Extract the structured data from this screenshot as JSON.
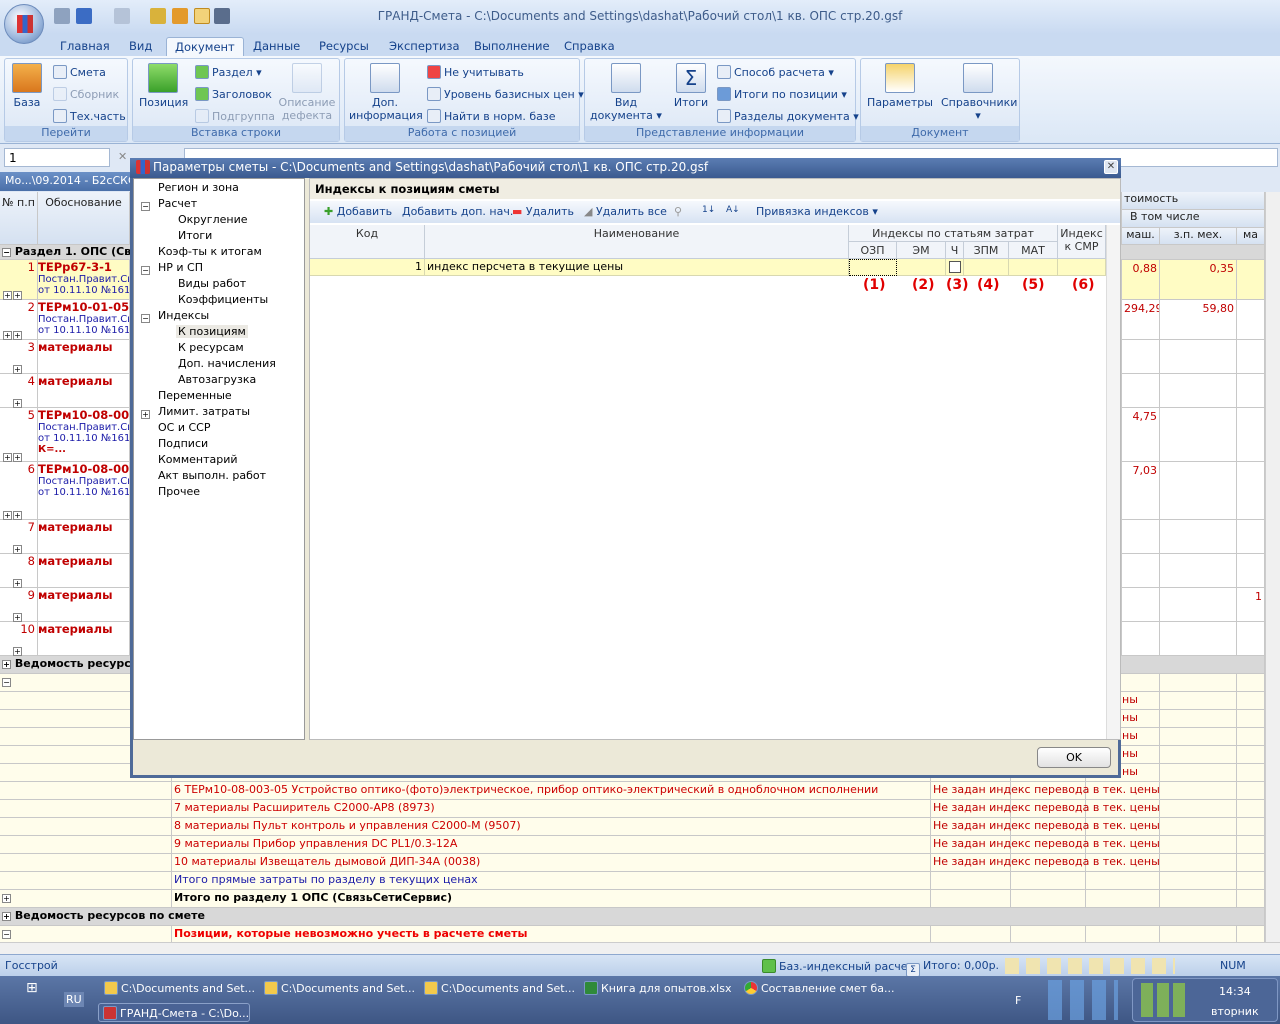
{
  "app": {
    "title": "ГРАНД-Смета - C:\\Documents and Settings\\dashat\\Рабочий стол\\1 кв.  ОПС стр.20.gsf"
  },
  "tabs": [
    "Главная",
    "Вид",
    "Документ",
    "Данные",
    "Ресурсы",
    "Экспертиза",
    "Выполнение",
    "Справка"
  ],
  "active_tab": "Документ",
  "ribbon": {
    "goto": {
      "label": "Перейти",
      "baza": "База",
      "smeta": "Смета",
      "sbornik": "Сборник",
      "techpart": "Тех.часть"
    },
    "insert": {
      "label": "Вставка строки",
      "position": "Позиция",
      "razdel": "Раздел",
      "zagolovok": "Заголовок",
      "podgruppa": "Подгруппа",
      "defect": "Описание дефекта"
    },
    "work": {
      "label": "Работа с позицией",
      "dop": "Доп. информация",
      "ne_uchit": "Не учитывать",
      "uroven": "Уровень базисных цен",
      "naiti": "Найти в норм. базе"
    },
    "view": {
      "label": "Представление информации",
      "vid": "Вид документа",
      "itogi": "Итоги",
      "sposob": "Способ расчета",
      "itogi_poz": "Итоги по позиции",
      "razdely": "Разделы документа"
    },
    "doc": {
      "label": "Документ",
      "params": "Параметры",
      "sprav": "Справочники"
    }
  },
  "formula": {
    "cell": "1"
  },
  "doc_tab": "Мо...\\09.2014 - Б2сСКС",
  "grid": {
    "headers": {
      "num": "№ п.п",
      "obosn": "Обоснование",
      "stoimost": "тоимость",
      "vtom": "В том числе",
      "mash": "маш.",
      "zpmeh": "з.п. мех.",
      "ma": "ма"
    },
    "section": "Раздел 1. ОПС (Связ",
    "rows": [
      {
        "n": "1",
        "code": "ТЕРр67-3-1",
        "sub1": "Постан.Правит.Св",
        "sub2": "от 10.11.10 №1616",
        "mash": "0,88",
        "zp": "0,35"
      },
      {
        "n": "2",
        "code": "ТЕРм10-01-055",
        "sub1": "Постан.Правит.Св",
        "sub2": "от 10.11.10 №1616",
        "mash": "294,29",
        "zp": "59,80"
      },
      {
        "n": "3",
        "code": "материалы"
      },
      {
        "n": "4",
        "code": "материалы"
      },
      {
        "n": "5",
        "code": "ТЕРм10-08-003",
        "sub1": "Постан.Правит.Св",
        "sub2": "от 10.11.10 №1616",
        "k": "К=...",
        "mash": "4,75"
      },
      {
        "n": "6",
        "code": "ТЕРм10-08-003",
        "sub1": "Постан.Правит.Св",
        "sub2": "от 10.11.10 №1616",
        "mash": "7,03"
      },
      {
        "n": "7",
        "code": "материалы"
      },
      {
        "n": "8",
        "code": "материалы"
      },
      {
        "n": "9",
        "code": "материалы",
        "ma": "1"
      },
      {
        "n": "10",
        "code": "материалы"
      }
    ],
    "vedomost": "Ведомость ресурсо",
    "msg_partial": "ны",
    "lower": [
      {
        "text": "6 ТЕРм10-08-003-05 Устройство оптико-(фото)электрическое, прибор оптико-электрический в одноблочном исполнении",
        "msg": "Не задан индекс перевода в тек. цены"
      },
      {
        "text": "7 материалы Расширитель С2000-АР8 (8973)",
        "msg": "Не задан индекс перевода в тек. цены"
      },
      {
        "text": "8 материалы Пульт контроль и управления С2000-М (9507)",
        "msg": "Не задан индекс перевода в тек. цены"
      },
      {
        "text": "9 материалы Прибор управления DC PL1/0.3-12А",
        "msg": "Не задан индекс перевода в тек. цены"
      },
      {
        "text": "10 материалы Извещатель дымовой ДИП-34А (0038)",
        "msg": "Не задан индекс перевода в тек. цены"
      }
    ],
    "itogo_pryamye": "Итого прямые затраты по разделу в текущих ценах",
    "itogo_razdel": "Итого по разделу 1 ОПС (СвязьСетиСервис)",
    "vedomost_smeta": "Ведомость ресурсов по смете",
    "pozicii": "Позиции, которые невозможно учесть в расчете сметы"
  },
  "status": {
    "left": "Госстрой",
    "calc": "Баз.-индексный расчет",
    "itogo": "Итого: 0,00р.",
    "num": "NUM"
  },
  "taskbar": {
    "lang": "RU",
    "items": [
      "C:\\Documents and Set...",
      "C:\\Documents and Set...",
      "C:\\Documents and Set...",
      "Книга для опытов.xlsx",
      "Составление смет ба...",
      "ГРАНД-Смета - C:\\Do..."
    ],
    "time": "14:34",
    "day": "вторник",
    "f": "F"
  },
  "dialog": {
    "title": "Параметры сметы - C:\\Documents and Settings\\dashat\\Рабочий стол\\1 кв.  ОПС стр.20.gsf",
    "tree": [
      {
        "label": "Регион и зона",
        "lvl": 0
      },
      {
        "label": "Расчет",
        "lvl": 0,
        "exp": "-"
      },
      {
        "label": "Округление",
        "lvl": 1
      },
      {
        "label": "Итоги",
        "lvl": 1
      },
      {
        "label": "Коэф-ты к итогам",
        "lvl": 0
      },
      {
        "label": "НР и СП",
        "lvl": 0,
        "exp": "-"
      },
      {
        "label": "Виды работ",
        "lvl": 1
      },
      {
        "label": "Коэффициенты",
        "lvl": 1
      },
      {
        "label": "Индексы",
        "lvl": 0,
        "exp": "-"
      },
      {
        "label": "К позициям",
        "lvl": 1,
        "sel": true
      },
      {
        "label": "К ресурсам",
        "lvl": 1
      },
      {
        "label": "Доп. начисления",
        "lvl": 1
      },
      {
        "label": "Автозагрузка",
        "lvl": 1
      },
      {
        "label": "Переменные",
        "lvl": 0
      },
      {
        "label": "Лимит. затраты",
        "lvl": 0,
        "exp": "+"
      },
      {
        "label": "ОС и ССР",
        "lvl": 0
      },
      {
        "label": "Подписи",
        "lvl": 0
      },
      {
        "label": "Комментарий",
        "lvl": 0
      },
      {
        "label": "Акт выполн. работ",
        "lvl": 0
      },
      {
        "label": "Прочее",
        "lvl": 0
      }
    ],
    "panel_title": "Индексы к позициям сметы",
    "toolbar": {
      "add": "Добавить",
      "add_extra": "Добавить доп. нач.",
      "delete": "Удалить",
      "delete_all": "Удалить все",
      "binding": "Привязка индексов"
    },
    "columns": {
      "code": "Код",
      "name": "Наименование",
      "group": "Индексы по статьям затрат",
      "ozp": "ОЗП",
      "em": "ЭМ",
      "ch": "Ч",
      "zpm": "ЗПМ",
      "mat": "МАТ",
      "smr": "Индекс к СМР"
    },
    "row": {
      "code": "1",
      "name": "индекс персчета в текущие цены",
      "ch_checked": false
    },
    "annotations": [
      "(1)",
      "(2)",
      "(3)",
      "(4)",
      "(5)",
      "(6)"
    ],
    "ok": "OK"
  }
}
